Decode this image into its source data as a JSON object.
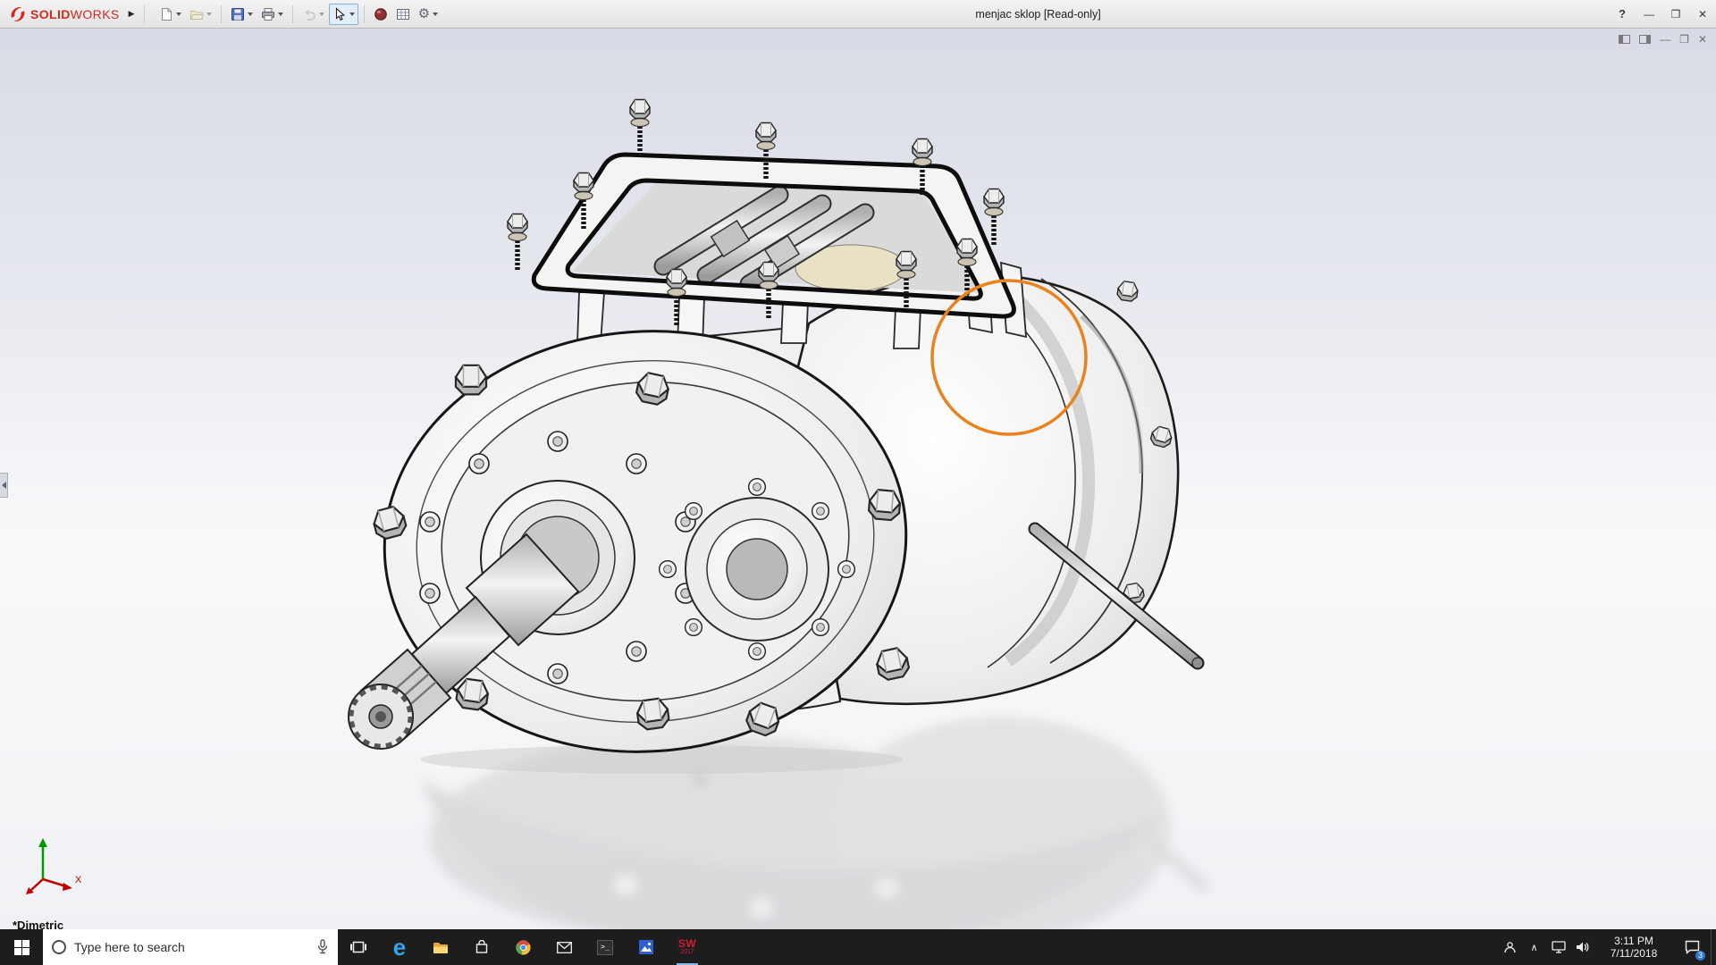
{
  "window": {
    "brand_bold": "SOLID",
    "brand_light": "WORKS",
    "brand_color": "#d6281e",
    "title": "menjac sklop [Read-only]"
  },
  "icons": {
    "flyout": "▶",
    "help": "?",
    "minimize": "—",
    "maximize": "❐",
    "close": "✕",
    "doc_minimize": "—",
    "doc_restore": "❐",
    "doc_close": "✕",
    "gear": "⚙",
    "edge": "e",
    "terminal": "&gt;_",
    "chevron_up": "∧"
  },
  "toolbar": {
    "buttons": [
      "new-document",
      "open",
      "save",
      "print",
      "undo",
      "select",
      "appearance",
      "display-settings",
      "options"
    ]
  },
  "viewport": {
    "view_orientation": "*Dimetric",
    "annotation_color": "#e8831f",
    "triad_x_label": "X"
  },
  "taskbar": {
    "search_placeholder": "Type here to search",
    "apps": [
      "task-view",
      "edge",
      "file-explorer",
      "store",
      "chrome",
      "mail",
      "terminal",
      "photos",
      "solidworks-2017"
    ],
    "sw_app": {
      "label": "SW",
      "year": "2017"
    },
    "tray": {
      "time": "3:11 PM",
      "date": "7/11/2018",
      "notification_count": "3"
    }
  }
}
